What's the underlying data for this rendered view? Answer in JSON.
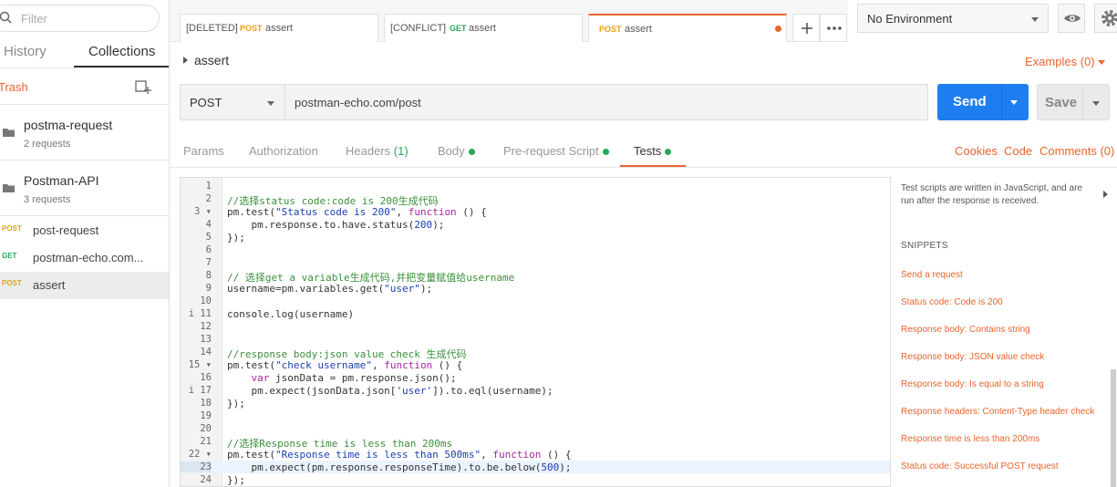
{
  "sidebar": {
    "filter_placeholder": "Filter",
    "tabs": [
      "History",
      "Collections"
    ],
    "trash_label": "Trash",
    "collections": [
      {
        "name": "postma-request",
        "count": "2 requests"
      },
      {
        "name": "Postman-API",
        "count": "3 requests"
      }
    ],
    "requests": [
      {
        "method": "POST",
        "name": "post-request",
        "color": "#e8a20c"
      },
      {
        "method": "GET",
        "name": "postman-echo.com...",
        "color": "#26a65b"
      },
      {
        "method": "POST",
        "name": "assert",
        "color": "#e8a20c"
      }
    ]
  },
  "tabs": [
    {
      "prefix": "[DELETED]",
      "method": "POST",
      "name": "assert"
    },
    {
      "prefix": "[CONFLICT]",
      "method": "GET",
      "name": "assert"
    },
    {
      "prefix": "",
      "method": "POST",
      "name": "assert"
    }
  ],
  "environment": {
    "selected": "No Environment"
  },
  "request": {
    "name": "assert",
    "examples": "Examples (0)",
    "method": "POST",
    "url": "postman-echo.com/post",
    "send_label": "Send",
    "save_label": "Save"
  },
  "subtabs": {
    "params": "Params",
    "authorization": "Authorization",
    "headers": "Headers",
    "headers_count": "(1)",
    "body": "Body",
    "prerequest": "Pre-request Script",
    "tests": "Tests",
    "cookies": "Cookies",
    "code": "Code",
    "comments": "Comments (0)"
  },
  "editor": {
    "lines": [
      {
        "n": "1",
        "text": ""
      },
      {
        "n": "2",
        "text": "//选择status code:code is 200生成代码"
      },
      {
        "n": "3 ▾",
        "text": "pm.test(\"Status code is 200\", function () {"
      },
      {
        "n": "4",
        "text": "    pm.response.to.have.status(200);"
      },
      {
        "n": "5",
        "text": "});"
      },
      {
        "n": "6",
        "text": ""
      },
      {
        "n": "7",
        "text": ""
      },
      {
        "n": "8",
        "text": "// 选择get a variable生成代码,并把变量赋值给username"
      },
      {
        "n": "9",
        "text": "username=pm.variables.get(\"user\");"
      },
      {
        "n": "10",
        "text": ""
      },
      {
        "n": "i 11",
        "text": "console.log(username)"
      },
      {
        "n": "12",
        "text": ""
      },
      {
        "n": "13",
        "text": ""
      },
      {
        "n": "14",
        "text": "//response body:json value check 生成代码"
      },
      {
        "n": "15 ▾",
        "text": "pm.test(\"check username\", function () {"
      },
      {
        "n": "16",
        "text": "    var jsonData = pm.response.json();"
      },
      {
        "n": "i 17",
        "text": "    pm.expect(jsonData.json['user']).to.eql(username);"
      },
      {
        "n": "18",
        "text": "});"
      },
      {
        "n": "19",
        "text": ""
      },
      {
        "n": "20",
        "text": ""
      },
      {
        "n": "21",
        "text": "//选择Response time is less than 200ms"
      },
      {
        "n": "22 ▾",
        "text": "pm.test(\"Response time is less than 500ms\", function () {"
      },
      {
        "n": "23",
        "text": "    pm.expect(pm.response.responseTime).to.be.below(500);"
      },
      {
        "n": "24",
        "text": "});"
      }
    ]
  },
  "snippets": {
    "help": "Test scripts are written in JavaScript, and are run after the response is received.",
    "heading": "SNIPPETS",
    "items": [
      "Send a request",
      "Status code: Code is 200",
      "Response body: Contains string",
      "Response body: JSON value check",
      "Response body: Is equal to a string",
      "Response headers: Content-Type header check",
      "Response time is less than 200ms",
      "Status code: Successful POST request"
    ]
  }
}
